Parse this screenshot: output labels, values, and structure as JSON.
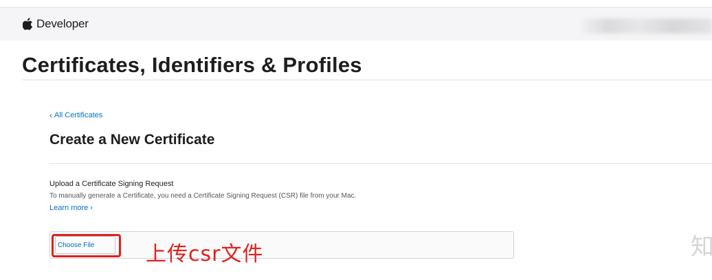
{
  "nav": {
    "brand_label": "Developer",
    "logo_icon": "apple-logo-icon"
  },
  "page": {
    "title": "Certificates, Identifiers & Profiles"
  },
  "breadcrumb": {
    "chevron": "‹",
    "back_label": "All Certificates"
  },
  "section": {
    "title": "Create a New Certificate"
  },
  "upload": {
    "heading": "Upload a Certificate Signing Request",
    "description": "To manually generate a Certificate, you need a Certificate Signing Request (CSR) file from your Mac.",
    "learn_more": "Learn more ›",
    "choose_file_label": "Choose File"
  },
  "annotation": {
    "text": "上传csr文件",
    "color": "#e3201c"
  },
  "watermark": {
    "text": "知"
  },
  "colors": {
    "link": "#0070c9",
    "highlight": "#e01f1f"
  }
}
